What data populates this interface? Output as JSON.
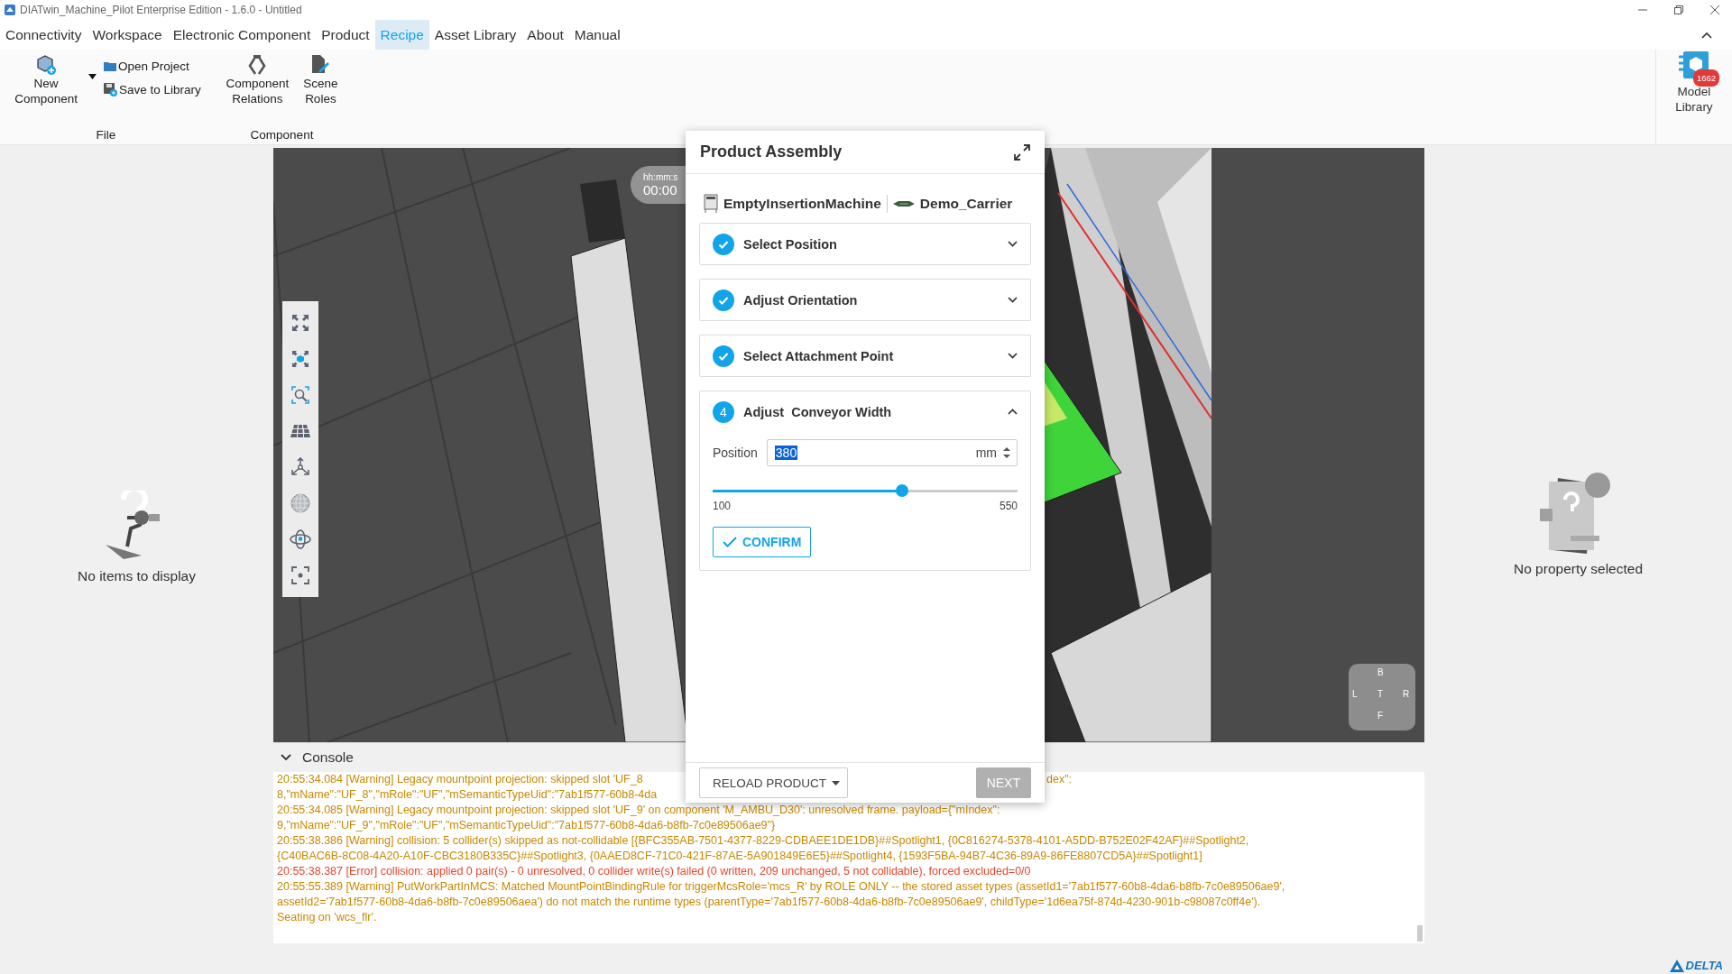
{
  "window": {
    "title": "DIATwin_Machine_Pilot Enterprise Edition - 1.6.0 - Untitled"
  },
  "menu": [
    {
      "label": "Connectivity",
      "selected": false
    },
    {
      "label": "Workspace",
      "selected": false
    },
    {
      "label": "Electronic Component",
      "selected": false
    },
    {
      "label": "Product",
      "selected": false
    },
    {
      "label": "Recipe",
      "selected": true
    },
    {
      "label": "Asset Library",
      "selected": false
    },
    {
      "label": "About",
      "selected": false
    },
    {
      "label": "Manual",
      "selected": false
    }
  ],
  "ribbon": {
    "file": {
      "label": "File",
      "new_component": "New Component",
      "open_project": "Open Project",
      "save_to_library": "Save to Library"
    },
    "component": {
      "label": "Component",
      "relations": "Component Relations",
      "scene_roles": "Scene Roles"
    },
    "model_library": {
      "label": "Model Library",
      "badge": "1662"
    }
  },
  "left_panel": {
    "empty_text": "No items to display"
  },
  "right_panel": {
    "empty_text": "No property selected"
  },
  "viewport": {
    "timer_label": "hh:mm:s",
    "timer_value": "00:00",
    "view_cube": [
      "B",
      "L",
      "T",
      "R",
      "F"
    ]
  },
  "dialog": {
    "title": "Product Assembly",
    "machine": "EmptyInsertionMachine",
    "carrier": "Demo_Carrier",
    "steps": [
      {
        "label": "Select Position",
        "completed": true,
        "expanded": false
      },
      {
        "label": "Adjust Orientation",
        "completed": true,
        "expanded": false
      },
      {
        "label": "Select Attachment Point",
        "completed": true,
        "expanded": false
      },
      {
        "label": "Adjust  Conveyor Width",
        "completed": false,
        "number": "4",
        "expanded": true,
        "field": {
          "label": "Position",
          "value": "380",
          "unit": "mm"
        },
        "slider": {
          "level": 0.62,
          "min": "100",
          "max": "550"
        },
        "confirm": "CONFIRM"
      }
    ],
    "reload": "RELOAD PRODUCT",
    "next": {
      "label": "NEXT",
      "disabled": true
    }
  },
  "console": {
    "title": "Console",
    "expanded": true,
    "lines": [
      {
        "kind": "warning",
        "text": "20:55:34.084 [Warning] Legacy mountpoint projection: skipped slot 'UF_8",
        "text_right": "dex\":"
      },
      {
        "kind": "warning",
        "text": "8,\"mName\":\"UF_8\",\"mRole\":\"UF\",\"mSemanticTypeUid\":\"7ab1f577-60b8-4da"
      },
      {
        "kind": "warning",
        "text": "20:55:34.085 [Warning] Legacy mountpoint projection: skipped slot 'UF_9' on component 'M_AMBU_D30': unresolved frame. payload={\"mIndex\":"
      },
      {
        "kind": "warning",
        "text": "9,\"mName\":\"UF_9\",\"mRole\":\"UF\",\"mSemanticTypeUid\":\"7ab1f577-60b8-4da6-b8fb-7c0e89506ae9\"}"
      },
      {
        "kind": "warning",
        "text": "20:55:38.386 [Warning] collision: 5 collider(s) skipped as not-collidable [{BFC355AB-7501-4377-8229-CDBAEE1DE1DB}##Spotlight1, {0C816274-5378-4101-A5DD-B752E02F42AF}##Spotlight2,"
      },
      {
        "kind": "warning",
        "text": "{C40BAC6B-8C08-4A20-A10F-CBC3180B335C}##Spotlight3, {0AAED8CF-71C0-421F-87AE-5A901849E6E5}##Spotlight4, {1593F5BA-94B7-4C36-89A9-86FE8807CD5A}##Spotlight1]"
      },
      {
        "kind": "error",
        "text": "20:55:38.387 [Error] collision: applied 0 pair(s) - 0 unresolved, 0 collider write(s) failed (0 written, 209 unchanged, 5 not collidable), forced excluded=0/0"
      },
      {
        "kind": "warning",
        "text": "20:55:55.389 [Warning] PutWorkPartInMCS: Matched MountPointBindingRule for triggerMcsRole='mcs_R' by ROLE ONLY -- the stored asset types (assetId1='7ab1f577-60b8-4da6-b8fb-7c0e89506ae9',"
      },
      {
        "kind": "warning",
        "text": "assetId2='7ab1f577-60b8-4da6-b8fb-7c0e89506aea') do not match the runtime types (parentType='7ab1f577-60b8-4da6-b8fb-7c0e89506ae9', childType='1d6ea75f-874d-4230-901b-c98087c0ff4e')."
      },
      {
        "kind": "warning",
        "text": "Seating on 'wcs_flr'."
      }
    ]
  },
  "status_bar": {
    "logo": "DELTA"
  }
}
